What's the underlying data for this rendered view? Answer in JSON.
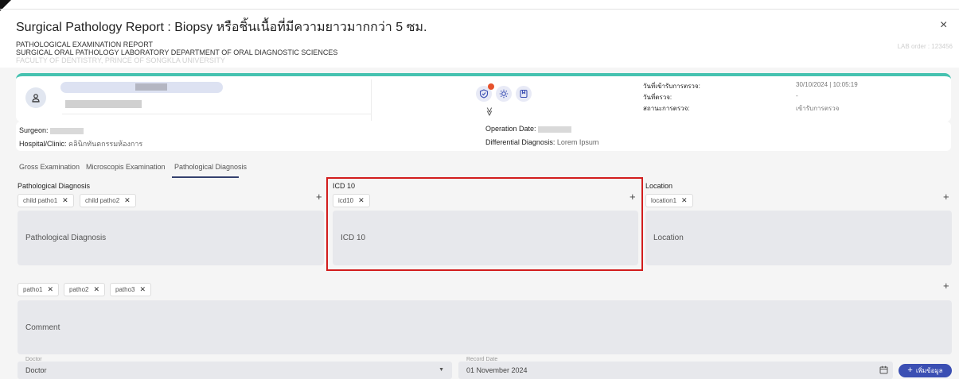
{
  "dialog": {
    "title": "Surgical Pathology Report : Biopsy หรือชิ้นเนื้อที่มีความยาวมากกว่า 5 ซม.",
    "close": "×"
  },
  "report_header": {
    "line1": "PATHOLOGICAL EXAMINATION REPORT",
    "line2": "SURGICAL ORAL PATHOLOGY LABORATORY DEPARTMENT OF ORAL DIAGNOSTIC SCIENCES",
    "line3": "FACULTY OF DENTISTRY, PRINCE OF SONGKLA UNIVERSITY",
    "lab_order": "LAB order : 123456"
  },
  "patient": {
    "toolbar_icons": [
      "shield-icon",
      "sun-icon",
      "bookmark-icon"
    ],
    "expand": "≫",
    "status": [
      {
        "label": "วันที่เข้ารับการตรวจ:",
        "value": "30/10/2024 | 10:05:19"
      },
      {
        "label": "วันที่ตรวจ:",
        "value": "-"
      },
      {
        "label": "สถานะการตรวจ:",
        "value": "เข้ารับการตรวจ"
      }
    ]
  },
  "surgery": {
    "surgeon_label": "Surgeon:",
    "hospital_label": "Hospital/Clinic:",
    "hospital_value": "คลินิกทันตกรรมห้องการ",
    "operation_date_label": "Operation Date:",
    "differential_label": "Differential Diagnosis:",
    "differential_value": "Lorem Ipsum"
  },
  "tabs": [
    "Gross Examination",
    "Microscopis Examination",
    "Pathological Diagnosis"
  ],
  "active_tab": "Pathological Diagnosis",
  "sections": {
    "pathological": {
      "label": "Pathological Diagnosis",
      "chips": [
        "child patho1",
        "child patho2"
      ],
      "placeholder": "Pathological Diagnosis"
    },
    "icd": {
      "label": "ICD 10",
      "chips": [
        "icd10"
      ],
      "placeholder": "ICD 10"
    },
    "location": {
      "label": "Location",
      "chips": [
        "location1"
      ],
      "placeholder": "Location"
    },
    "comment": {
      "chips": [
        "patho1",
        "patho2",
        "patho3"
      ],
      "placeholder": "Comment"
    }
  },
  "footer": {
    "doctor_label": "Doctor",
    "doctor_value": "Doctor",
    "record_date_label": "Record Date",
    "record_date_value": "01 November 2024",
    "add_button": "เพิ่มข้อมูล"
  },
  "colors": {
    "accent": "#46c2b0",
    "primary": "#3b4fb3",
    "highlight": "#d21d1d",
    "badge": "#e6522c"
  }
}
